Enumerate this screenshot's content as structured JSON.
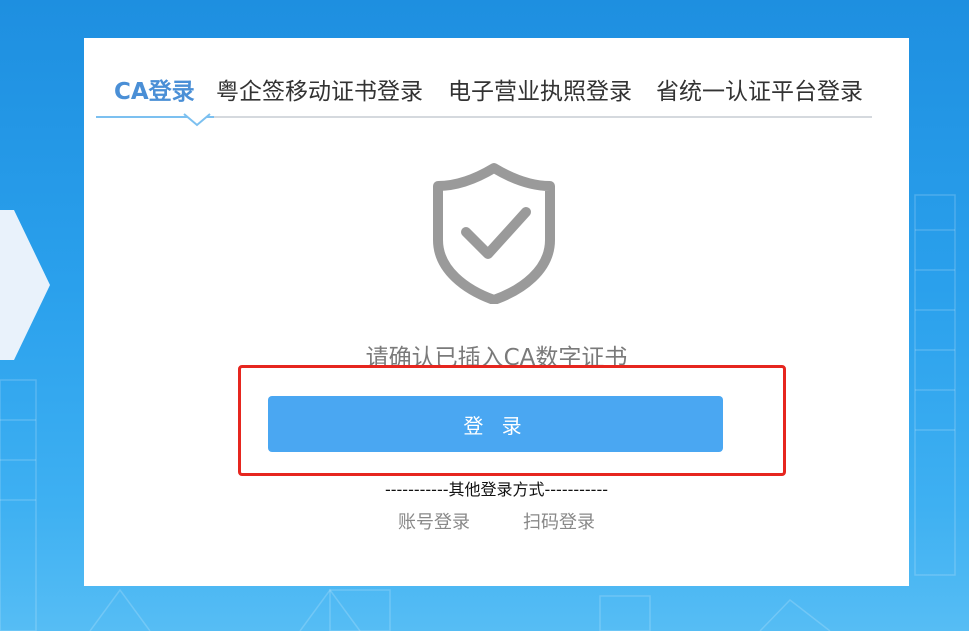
{
  "tabs": [
    {
      "label": "CA登录",
      "active": true
    },
    {
      "label": "粤企签移动证书登录",
      "active": false
    },
    {
      "label": "电子营业执照登录",
      "active": false
    },
    {
      "label": "省统一认证平台登录",
      "active": false
    }
  ],
  "shield": {
    "icon": "shield-check-icon",
    "color": "#9a9a9a"
  },
  "hint_text": "请确认已插入CA数字证书",
  "login_button": {
    "label": "登 录",
    "color": "#4aa7f2"
  },
  "other_methods": {
    "title": "-----------其他登录方式-----------",
    "links": [
      "账号登录",
      "扫码登录"
    ]
  },
  "colors": {
    "active_tab": "#4a8fd6",
    "background": "#2aa0ec",
    "highlight_border": "#e6261f"
  }
}
